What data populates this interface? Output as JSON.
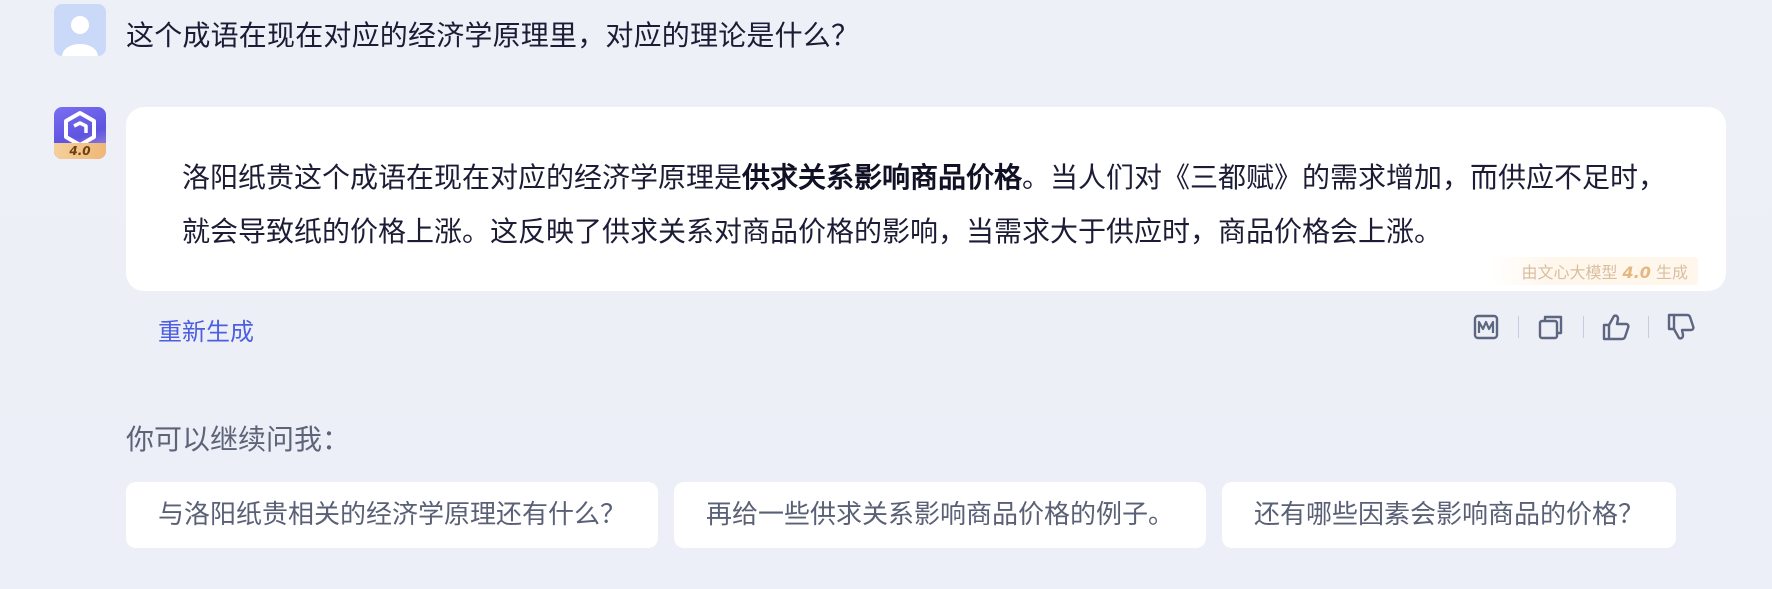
{
  "user": {
    "question": "这个成语在现在对应的经济学原理里，对应的理论是什么？"
  },
  "bot": {
    "badge": "4.0",
    "answer_prefix": "洛阳纸贵这个成语在现在对应的经济学原理是",
    "answer_bold": "供求关系影响商品价格",
    "answer_suffix": "。当人们对《三都赋》的需求增加，而供应不足时，就会导致纸的价格上涨。这反映了供求关系对商品价格的影响，当需求大于供应时，商品价格会上涨。",
    "gen_tag_pre": "由文心大模型",
    "gen_tag_version": "4.0",
    "gen_tag_post": "生成"
  },
  "actions": {
    "regenerate_label": "重新生成",
    "icons": [
      "share-image-icon",
      "copy-icon",
      "thumbs-up-icon",
      "thumbs-down-icon"
    ]
  },
  "followup": {
    "label": "你可以继续问我：",
    "suggestions": [
      "与洛阳纸贵相关的经济学原理还有什么？",
      "再给一些供求关系影响商品价格的例子。",
      "还有哪些因素会影响商品的价格？"
    ]
  },
  "colors": {
    "link": "#4c5fe0",
    "icon": "#5c6680",
    "bot_gradient_start": "#7a6ef2",
    "badge": "#efb777"
  }
}
